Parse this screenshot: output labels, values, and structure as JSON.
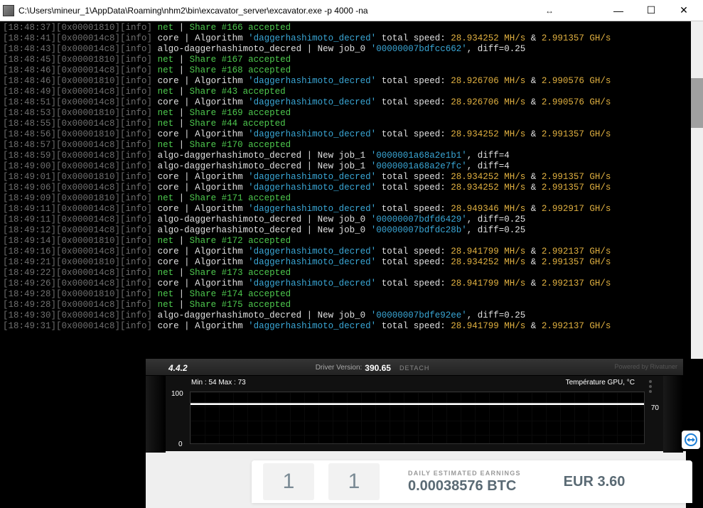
{
  "window": {
    "title": "C:\\Users\\mineur_1\\AppData\\Roaming\\nhm2\\bin\\excavator_server\\excavator.exe  -p 4000 -na",
    "drag": "↔"
  },
  "log": [
    {
      "ts": "18:48:37",
      "id": "0x00001810",
      "lvl": "info",
      "m": "net",
      "txt": "Share #166 accepted"
    },
    {
      "ts": "18:48:41",
      "id": "0x000014c8",
      "lvl": "info",
      "m": "core",
      "algo": "daggerhashimoto_decred",
      "speed": "28.934252 MH/s",
      "speed2": "2.991357 GH/s"
    },
    {
      "ts": "18:48:43",
      "id": "0x000014c8",
      "lvl": "info",
      "m": "algo",
      "job": "job_0",
      "hash": "00000007bdfcc662",
      "diff": "0.25"
    },
    {
      "ts": "18:48:45",
      "id": "0x00001810",
      "lvl": "info",
      "m": "net",
      "txt": "Share #167 accepted"
    },
    {
      "ts": "18:48:46",
      "id": "0x000014c8",
      "lvl": "info",
      "m": "net",
      "txt": "Share #168 accepted"
    },
    {
      "ts": "18:48:46",
      "id": "0x00001810",
      "lvl": "info",
      "m": "core",
      "algo": "daggerhashimoto_decred",
      "speed": "28.926706 MH/s",
      "speed2": "2.990576 GH/s"
    },
    {
      "ts": "18:48:49",
      "id": "0x000014c8",
      "lvl": "info",
      "m": "net",
      "txt": "Share #43 accepted"
    },
    {
      "ts": "18:48:51",
      "id": "0x000014c8",
      "lvl": "info",
      "m": "core",
      "algo": "daggerhashimoto_decred",
      "speed": "28.926706 MH/s",
      "speed2": "2.990576 GH/s"
    },
    {
      "ts": "18:48:53",
      "id": "0x00001810",
      "lvl": "info",
      "m": "net",
      "txt": "Share #169 accepted"
    },
    {
      "ts": "18:48:55",
      "id": "0x000014c8",
      "lvl": "info",
      "m": "net",
      "txt": "Share #44 accepted"
    },
    {
      "ts": "18:48:56",
      "id": "0x00001810",
      "lvl": "info",
      "m": "core",
      "algo": "daggerhashimoto_decred",
      "speed": "28.934252 MH/s",
      "speed2": "2.991357 GH/s"
    },
    {
      "ts": "18:48:57",
      "id": "0x000014c8",
      "lvl": "info",
      "m": "net",
      "txt": "Share #170 accepted"
    },
    {
      "ts": "18:48:59",
      "id": "0x000014c8",
      "lvl": "info",
      "m": "algo",
      "job": "job_1",
      "hash": "0000001a68a2e1b1",
      "diff": "4"
    },
    {
      "ts": "18:49:00",
      "id": "0x000014c8",
      "lvl": "info",
      "m": "algo",
      "job": "job_1",
      "hash": "0000001a68a2e7fc",
      "diff": "4"
    },
    {
      "ts": "18:49:01",
      "id": "0x00001810",
      "lvl": "info",
      "m": "core",
      "algo": "daggerhashimoto_decred",
      "speed": "28.934252 MH/s",
      "speed2": "2.991357 GH/s"
    },
    {
      "ts": "18:49:06",
      "id": "0x000014c8",
      "lvl": "info",
      "m": "core",
      "algo": "daggerhashimoto_decred",
      "speed": "28.934252 MH/s",
      "speed2": "2.991357 GH/s"
    },
    {
      "ts": "18:49:09",
      "id": "0x00001810",
      "lvl": "info",
      "m": "net",
      "txt": "Share #171 accepted"
    },
    {
      "ts": "18:49:11",
      "id": "0x000014c8",
      "lvl": "info",
      "m": "core",
      "algo": "daggerhashimoto_decred",
      "speed": "28.949346 MH/s",
      "speed2": "2.992917 GH/s"
    },
    {
      "ts": "18:49:11",
      "id": "0x000014c8",
      "lvl": "info",
      "m": "algo",
      "job": "job_0",
      "hash": "00000007bdfd6429",
      "diff": "0.25"
    },
    {
      "ts": "18:49:12",
      "id": "0x000014c8",
      "lvl": "info",
      "m": "algo",
      "job": "job_0",
      "hash": "00000007bdfdc28b",
      "diff": "0.25"
    },
    {
      "ts": "18:49:14",
      "id": "0x00001810",
      "lvl": "info",
      "m": "net",
      "txt": "Share #172 accepted"
    },
    {
      "ts": "18:49:16",
      "id": "0x000014c8",
      "lvl": "info",
      "m": "core",
      "algo": "daggerhashimoto_decred",
      "speed": "28.941799 MH/s",
      "speed2": "2.992137 GH/s"
    },
    {
      "ts": "18:49:21",
      "id": "0x00001810",
      "lvl": "info",
      "m": "core",
      "algo": "daggerhashimoto_decred",
      "speed": "28.934252 MH/s",
      "speed2": "2.991357 GH/s"
    },
    {
      "ts": "18:49:22",
      "id": "0x000014c8",
      "lvl": "info",
      "m": "net",
      "txt": "Share #173 accepted"
    },
    {
      "ts": "18:49:26",
      "id": "0x000014c8",
      "lvl": "info",
      "m": "core",
      "algo": "daggerhashimoto_decred",
      "speed": "28.941799 MH/s",
      "speed2": "2.992137 GH/s"
    },
    {
      "ts": "18:49:28",
      "id": "0x00001810",
      "lvl": "info",
      "m": "net",
      "txt": "Share #174 accepted"
    },
    {
      "ts": "18:49:28",
      "id": "0x000014c8",
      "lvl": "info",
      "m": "net",
      "txt": "Share #175 accepted"
    },
    {
      "ts": "18:49:30",
      "id": "0x000014c8",
      "lvl": "info",
      "m": "algo",
      "job": "job_0",
      "hash": "00000007bdfe92ee",
      "diff": "0.25"
    },
    {
      "ts": "18:49:31",
      "id": "0x000014c8",
      "lvl": "info",
      "m": "core",
      "algo": "daggerhashimoto_decred",
      "speed": "28.941799 MH/s",
      "speed2": "2.992137 GH/s"
    }
  ],
  "gpu": {
    "version": "4.4.2",
    "driver_label": "Driver Version:",
    "driver": "390.65",
    "detach": "DETACH",
    "powered": "Powered by Rivatuner",
    "minmax": "Min : 54    Max : 73",
    "title": "Température GPU, °C",
    "axis100": "100",
    "axis0": "0",
    "axis70": "70"
  },
  "cards": {
    "n1": "1",
    "n2": "1",
    "earn_label": "DAILY ESTIMATED EARNINGS",
    "btc": "0.00038576 BTC",
    "eur": "EUR 3.60"
  },
  "tv": "↔"
}
